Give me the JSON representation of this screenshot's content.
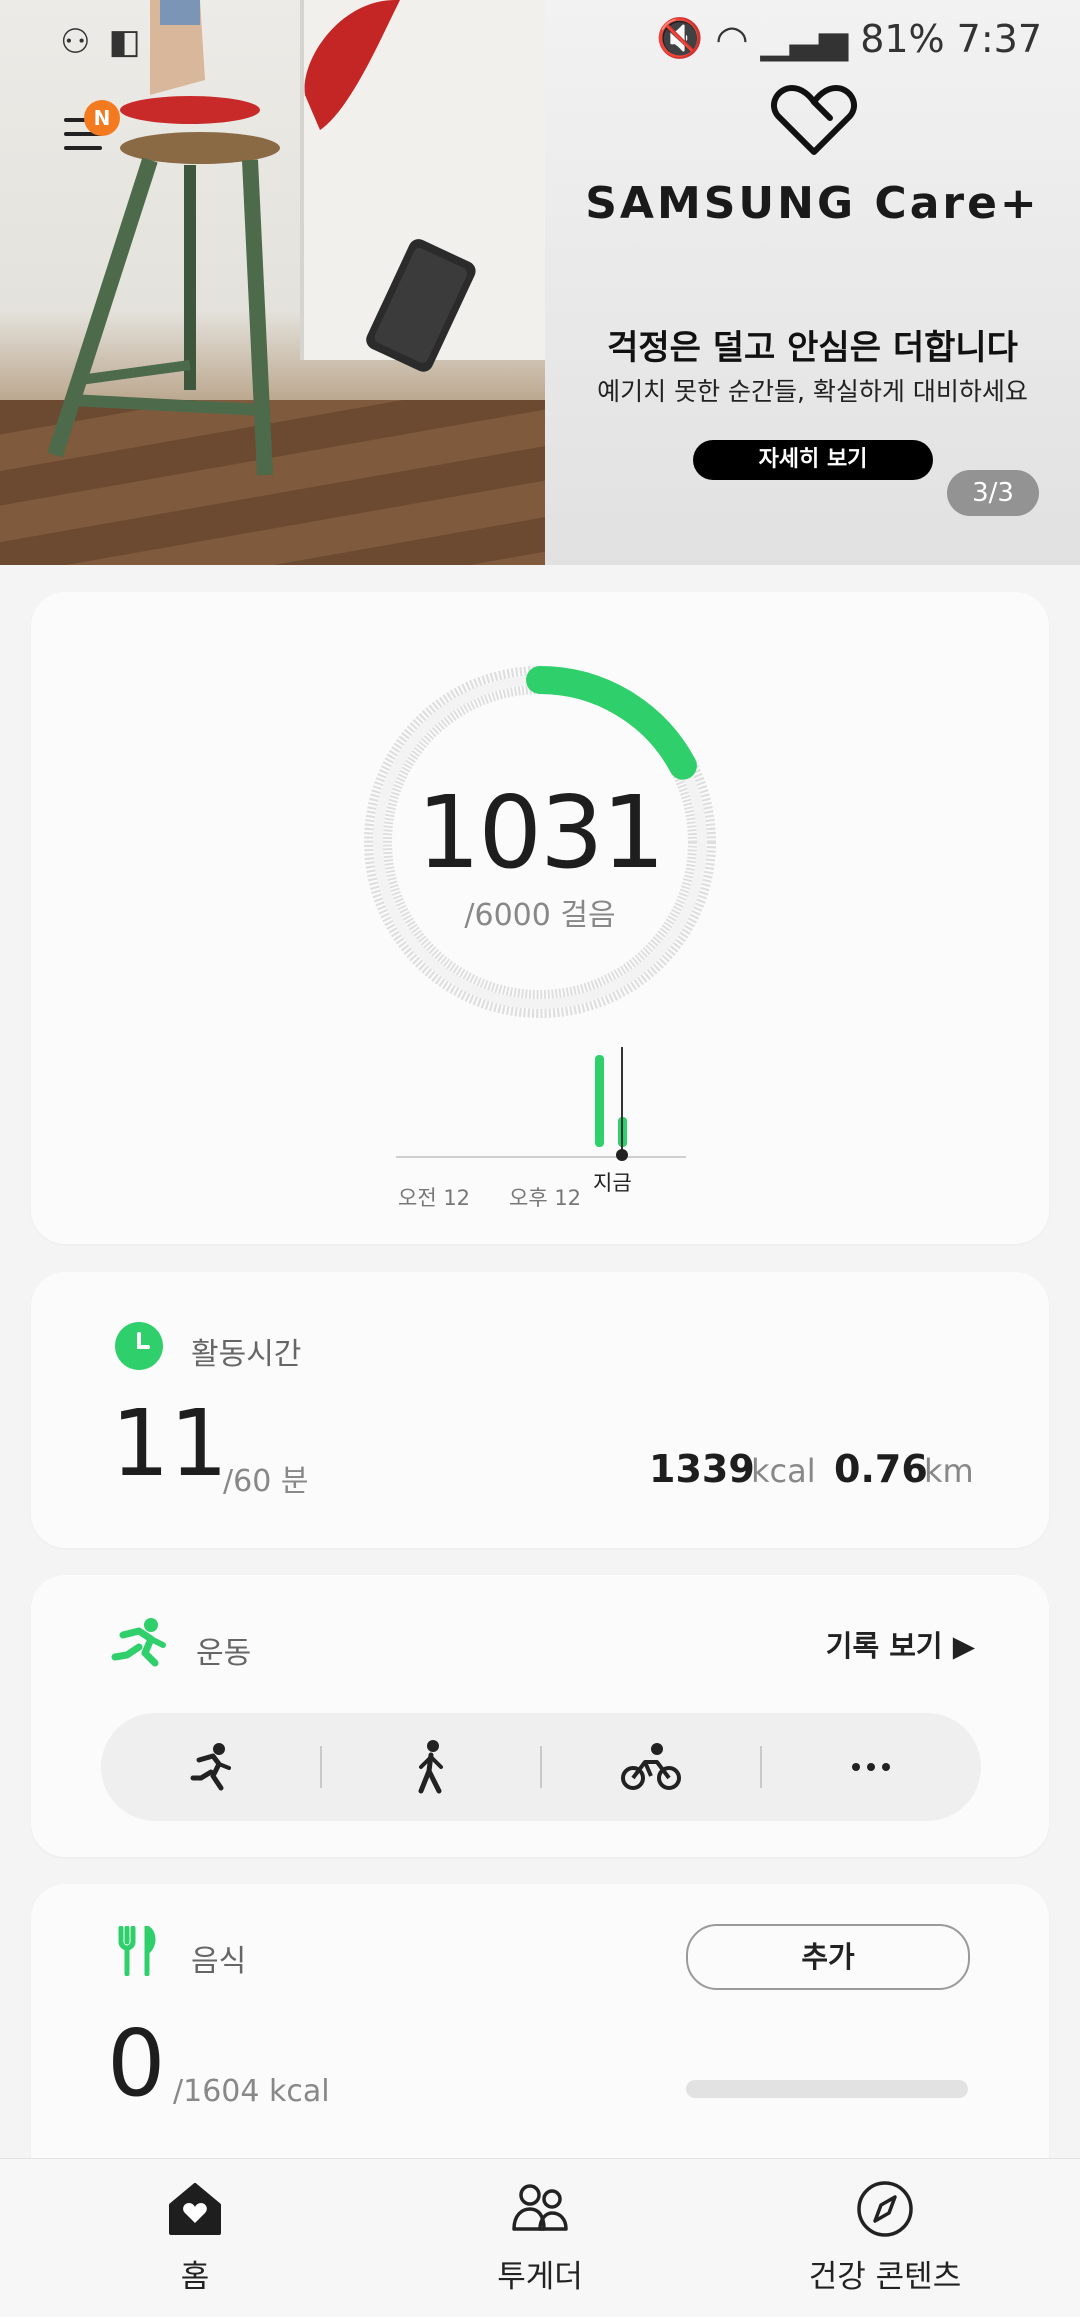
{
  "status_bar": {
    "battery": "81%",
    "time": "7:37"
  },
  "banner": {
    "notification_badge": "N",
    "brand": "SAMSUNG Care+",
    "promo_title": "걱정은 덜고 안심은 더합니다",
    "promo_subtitle": "예기치 못한 순간들, 확실하게 대비하세요",
    "promo_button": "자세히 보기",
    "page_indicator": "3/3"
  },
  "steps": {
    "count": "1031",
    "goal_label": "/6000 걸음",
    "count_value": 1031,
    "goal_value": 6000,
    "ring_color": "#2fd06b",
    "chart_labels": {
      "midnight": "오전 12",
      "noon": "오후 12",
      "now": "지금"
    }
  },
  "activity": {
    "title": "활동시간",
    "minutes": "11",
    "goal": "/60 분",
    "kcal_value": "1339",
    "kcal_unit": "kcal",
    "distance_value": "0.76",
    "distance_unit": "km",
    "accent_color": "#2fd06b"
  },
  "exercise": {
    "title": "운동",
    "history_link": "기록 보기 ▶",
    "types": [
      "running-icon",
      "walking-icon",
      "cycling-icon",
      "more-icon"
    ]
  },
  "food": {
    "title": "음식",
    "add_button": "추가",
    "kcal": "0",
    "goal": "/1604 kcal",
    "progress": 0
  },
  "bottom_nav": {
    "home": "홈",
    "together": "투게더",
    "health_content": "건강 콘텐츠"
  }
}
